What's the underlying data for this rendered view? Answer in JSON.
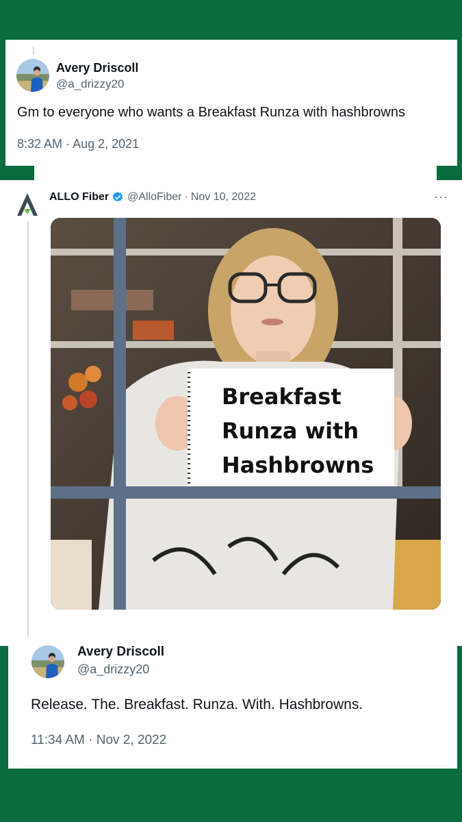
{
  "tweet1": {
    "author_name": "Avery Driscoll",
    "author_handle": "@a_drizzy20",
    "text": "Gm to everyone who wants a Breakfast Runza with hashbrowns",
    "time": "8:32 AM",
    "date": "Aug 2, 2021",
    "separator": "·"
  },
  "quoted": {
    "author_name": "ALLO Fiber",
    "author_handle": "@AlloFiber",
    "separator": "·",
    "date": "Nov 10, 2022",
    "more": "···",
    "logo_icon": "allo-logo-icon",
    "verified_icon": "verified-badge-icon",
    "sign_lines": [
      "Breakfast",
      "Runza with",
      "Hashbrowns"
    ]
  },
  "tweet2": {
    "author_name": "Avery Driscoll",
    "author_handle": "@a_drizzy20",
    "text": "Release. The. Breakfast. Runza. With. Hashbrowns.",
    "time": "11:34 AM",
    "date": "Nov 2, 2022",
    "separator": "·"
  },
  "colors": {
    "background": "#0a6b3c",
    "card": "#ffffff",
    "text_primary": "#0f1419",
    "text_secondary": "#536471",
    "verified": "#1d9bf0"
  }
}
